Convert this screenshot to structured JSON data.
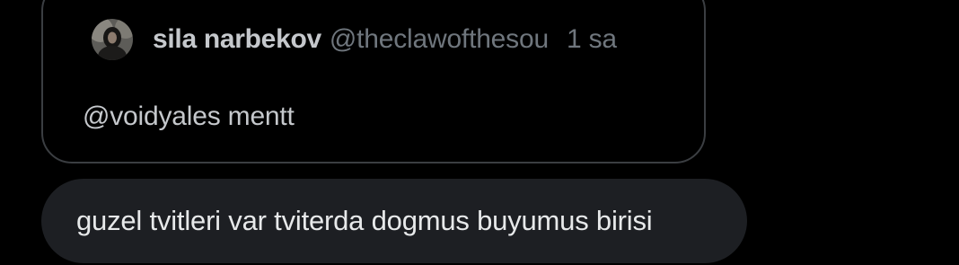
{
  "quoted_post": {
    "author": {
      "display_name": "sila narbekov",
      "handle": "@theclawofthesou",
      "avatar_icon": "profile-photo"
    },
    "timestamp": "1 sa",
    "text": "@voidyales mentt"
  },
  "message": {
    "text": "guzel tvitleri var tviterda dogmus buyumus birisi"
  },
  "colors": {
    "background": "#000000",
    "card_border": "#3b3e42",
    "bubble_background": "#1d1f23",
    "primary_text": "#e7e9ea",
    "secondary_text": "#6f767d"
  }
}
